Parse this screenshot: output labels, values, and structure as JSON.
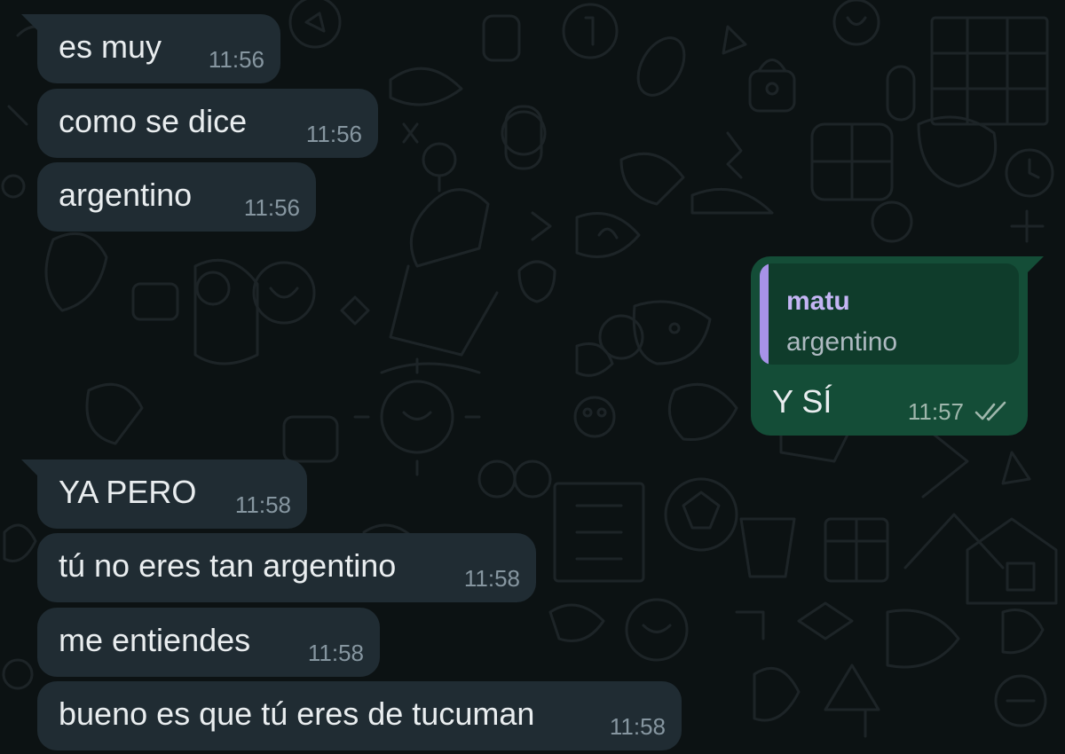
{
  "messages_top": [
    {
      "text": "es muy",
      "time": "11:56"
    },
    {
      "text": "como se dice",
      "time": "11:56"
    },
    {
      "text": "argentino",
      "time": "11:56"
    }
  ],
  "outgoing": {
    "quote_author": "matu",
    "quote_text": "argentino",
    "text": "Y SÍ",
    "time": "11:57",
    "status_icon": "double-check-icon"
  },
  "messages_bottom": [
    {
      "text": "YA PERO",
      "time": "11:58"
    },
    {
      "text": "tú no eres tan argentino",
      "time": "11:58"
    },
    {
      "text": "me entiendes",
      "time": "11:58"
    },
    {
      "text": "bueno es que tú eres de tucuman",
      "time": "11:58"
    }
  ],
  "colors": {
    "chat_background": "#0c1213",
    "incoming_bubble": "#202c33",
    "outgoing_bubble": "#144d37",
    "quote_accent": "#a792e8",
    "timestamp": "#8696a0",
    "text": "#e9edef"
  }
}
